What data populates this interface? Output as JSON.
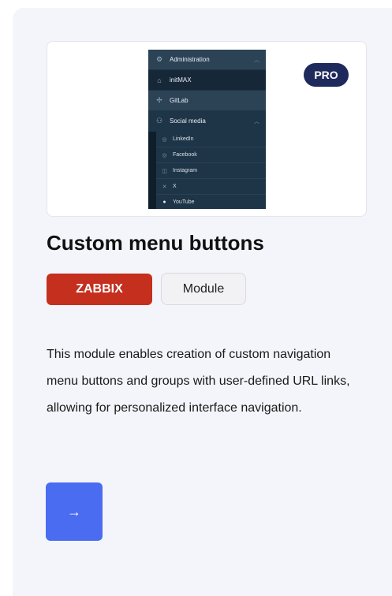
{
  "preview": {
    "menu": {
      "items": [
        {
          "label": "Administration",
          "icon": "gear-icon"
        },
        {
          "label": "initMAX",
          "icon": "home-icon"
        },
        {
          "label": "GitLab",
          "icon": "puzzle-icon"
        },
        {
          "label": "Social media",
          "icon": "group-icon"
        }
      ],
      "subitems": [
        {
          "label": "LinkedIn",
          "icon": "link-icon"
        },
        {
          "label": "Facebook",
          "icon": "circle-icon"
        },
        {
          "label": "Instagram",
          "icon": "camera-icon"
        },
        {
          "label": "X",
          "icon": "x-icon"
        },
        {
          "label": "YouTube",
          "icon": "play-icon"
        }
      ]
    },
    "badge": "PRO"
  },
  "title": "Custom menu buttons",
  "tags": {
    "vendor": "ZABBIX",
    "kind": "Module"
  },
  "description": "This module enables creation of custom navigation menu buttons and groups with user-defined URL links, allowing for personalized interface navigation.",
  "action": {
    "arrow": "→"
  },
  "colors": {
    "zabbix_red": "#c42f1e",
    "pro_navy": "#1f2a5c",
    "button_blue": "#4a6cf0",
    "menu_bg": "#1e3447"
  }
}
